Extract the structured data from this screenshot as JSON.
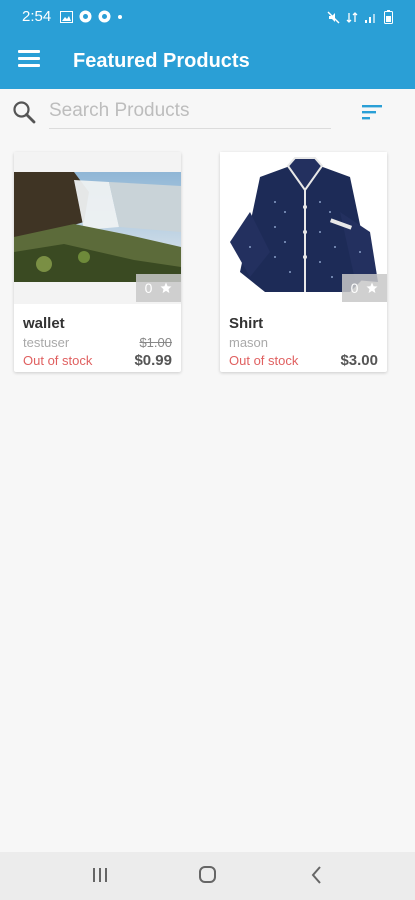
{
  "status_bar": {
    "time": "2:54"
  },
  "app_bar": {
    "title": "Featured Products"
  },
  "search": {
    "placeholder": "Search Products"
  },
  "products": [
    {
      "name": "wallet",
      "seller": "testuser",
      "stock_status": "Out of stock",
      "original_price": "$1.00",
      "price": "$0.99",
      "rating_count": "0"
    },
    {
      "name": "Shirt",
      "seller": "mason",
      "stock_status": "Out of stock",
      "original_price": "",
      "price": "$3.00",
      "rating_count": "0"
    }
  ],
  "colors": {
    "primary": "#2a9fd6",
    "out_of_stock": "#e06060",
    "background": "#f7f7f7"
  },
  "icons": {
    "menu": "hamburger-menu-icon",
    "search": "search-icon",
    "filter": "sort-filter-icon",
    "rating": "star-icon",
    "nav_recents": "recents-icon",
    "nav_home": "home-icon",
    "nav_back": "back-icon"
  }
}
